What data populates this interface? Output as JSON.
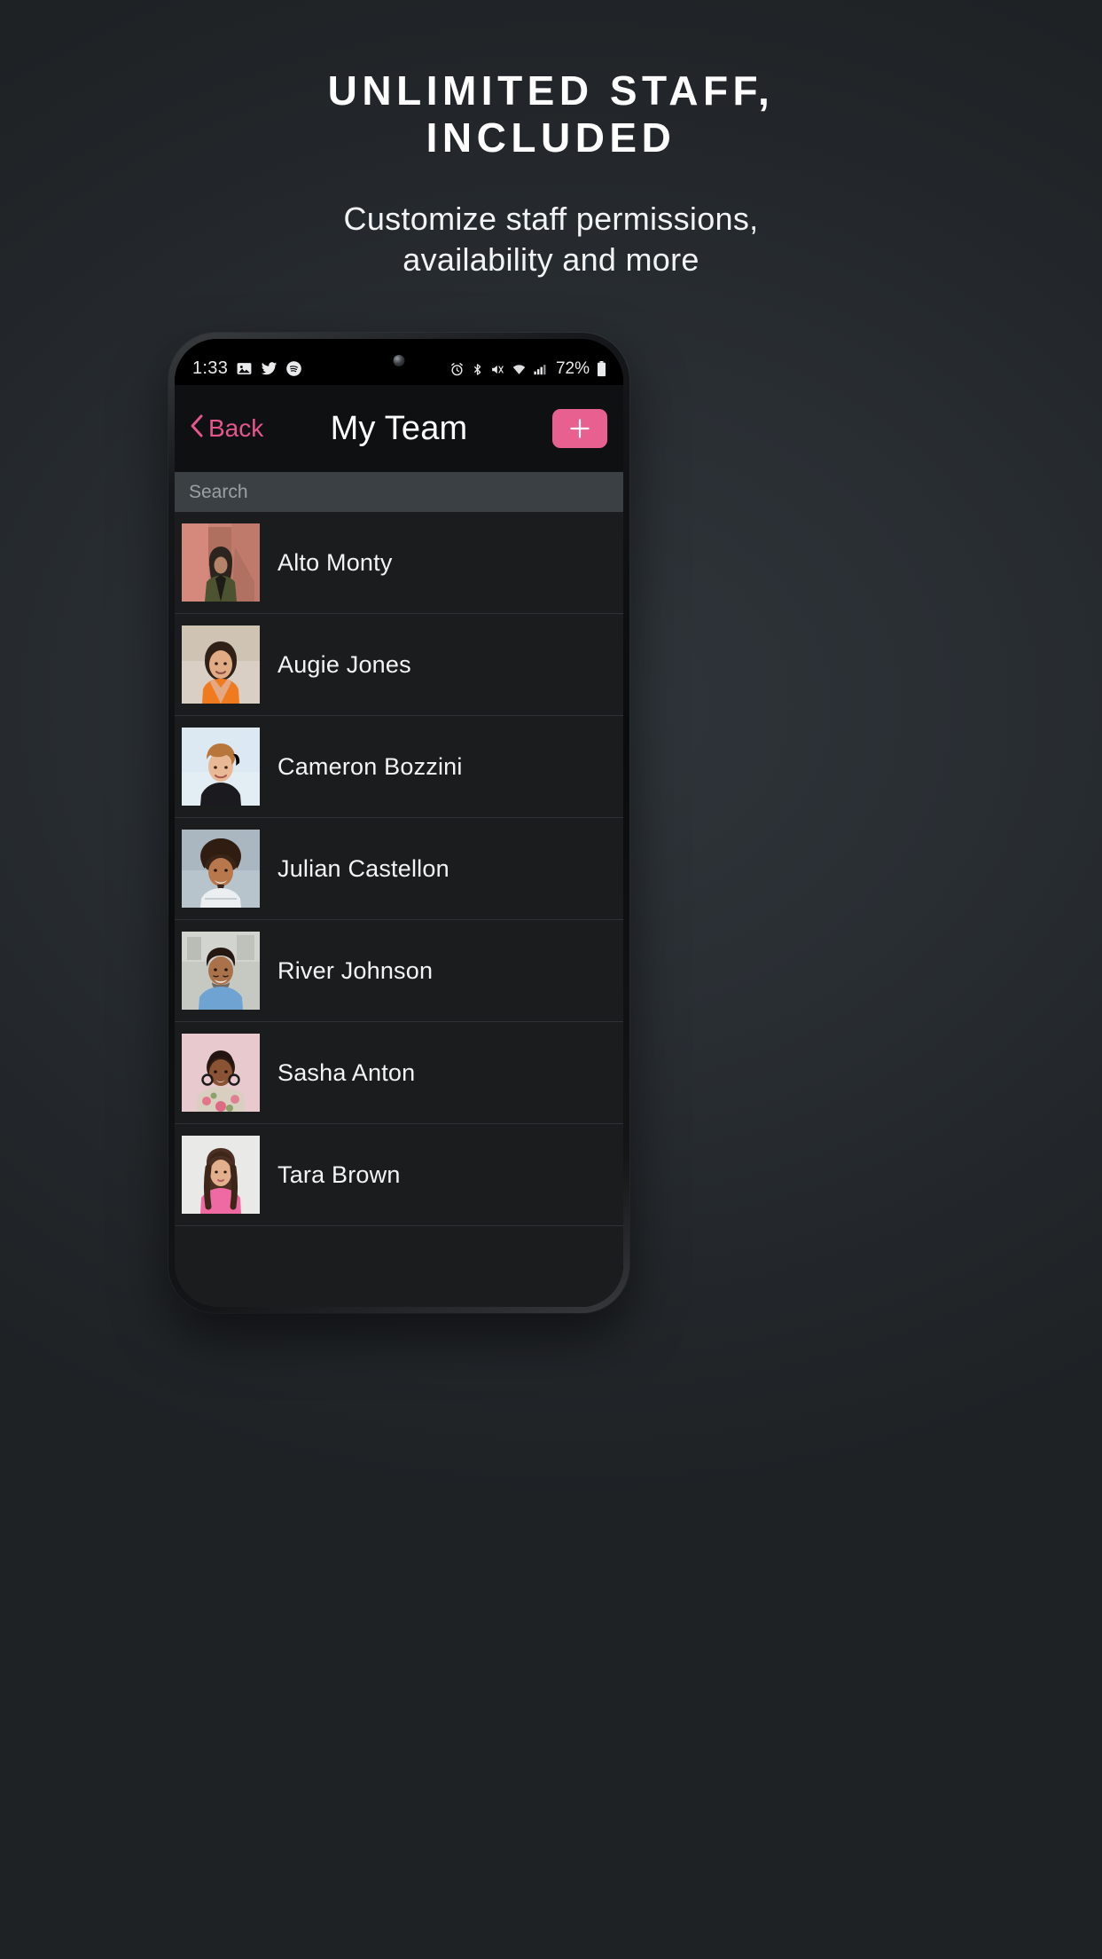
{
  "promo": {
    "headline_line1": "UNLIMITED STAFF,",
    "headline_line2": "INCLUDED",
    "subtitle_line1": "Customize staff permissions,",
    "subtitle_line2": "availability and more"
  },
  "colors": {
    "background": "#2b3035",
    "accent_pink": "#e8608f",
    "back_link": "#e4568c",
    "screen_bg": "#1a1c1e",
    "navbar_bg": "#0f1012",
    "search_bg": "#3b4044",
    "row_divider": "#2e3235",
    "text_primary": "#ffffff"
  },
  "phone": {
    "status_bar": {
      "time": "1:33",
      "left_icons": [
        "photos-icon",
        "twitter-icon",
        "spotify-icon"
      ],
      "right_icons": [
        "alarm-icon",
        "bluetooth-icon",
        "vibrate-icon",
        "wifi-icon",
        "cellular-signal-icon"
      ],
      "battery_percent": "72%",
      "battery_icon": "battery-icon"
    },
    "navbar": {
      "back_label": "Back",
      "back_icon": "chevron-left-icon",
      "title": "My Team",
      "add_icon": "plus-icon"
    },
    "search": {
      "placeholder": "Search",
      "value": ""
    },
    "team": [
      {
        "name": "Alto Monty",
        "avatar": "avatar-alto-monty"
      },
      {
        "name": "Augie Jones",
        "avatar": "avatar-augie-jones"
      },
      {
        "name": "Cameron Bozzini",
        "avatar": "avatar-cameron-bozzini"
      },
      {
        "name": "Julian Castellon",
        "avatar": "avatar-julian-castellon"
      },
      {
        "name": "River Johnson",
        "avatar": "avatar-river-johnson"
      },
      {
        "name": "Sasha Anton",
        "avatar": "avatar-sasha-anton"
      },
      {
        "name": "Tara Brown",
        "avatar": "avatar-tara-brown"
      }
    ]
  }
}
